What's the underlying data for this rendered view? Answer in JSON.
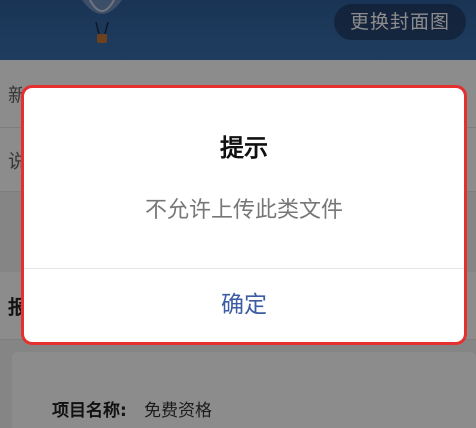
{
  "header": {
    "change_cover_label": "更换封面图"
  },
  "background": {
    "row1_peek": "新",
    "row2_peek": "说",
    "section_peek": "报",
    "project_label": "项目名称:",
    "project_value": "免费资格"
  },
  "dialog": {
    "title": "提示",
    "message": "不允许上传此类文件",
    "confirm_label": "确定"
  },
  "colors": {
    "confirm_text": "#3b5ba5",
    "highlight_border": "#e53030"
  }
}
